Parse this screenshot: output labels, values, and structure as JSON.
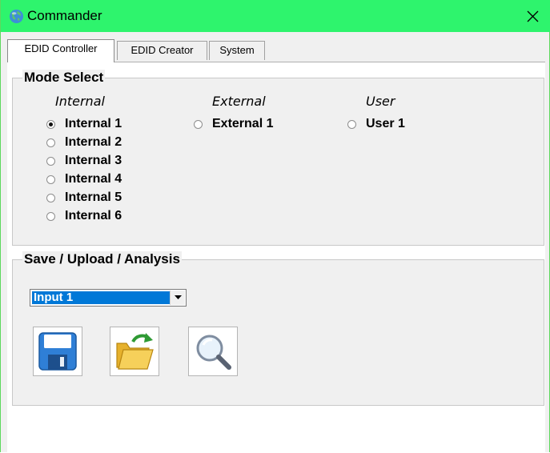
{
  "window": {
    "title": "Commander",
    "icon": "globe-icon",
    "close_icon": "close-icon",
    "titlebar_color": "#2ef46d"
  },
  "tabs": [
    {
      "label": "EDID Controller",
      "active": true
    },
    {
      "label": "EDID Creator",
      "active": false
    },
    {
      "label": "System",
      "active": false
    }
  ],
  "mode_select": {
    "title": "Mode Select",
    "columns": [
      {
        "header": "Internal",
        "options": [
          "Internal 1",
          "Internal 2",
          "Internal 3",
          "Internal 4",
          "Internal 5",
          "Internal 6"
        ]
      },
      {
        "header": "External",
        "options": [
          "External 1"
        ]
      },
      {
        "header": "User",
        "options": [
          "User 1"
        ]
      }
    ],
    "selected": "Internal 1"
  },
  "save_upload": {
    "title": "Save / Upload / Analysis",
    "input_select": {
      "value": "Input 1",
      "arrow_icon": "chevron-down-icon"
    },
    "buttons": [
      {
        "name": "save-button",
        "icon": "floppy-disk-icon"
      },
      {
        "name": "upload-button",
        "icon": "folder-upload-icon"
      },
      {
        "name": "analysis-button",
        "icon": "magnifier-icon"
      }
    ]
  },
  "colors": {
    "accent": "#0078d7",
    "floppy": "#2f7fd6",
    "folder": "#f6c743",
    "arrow": "#2f9a34"
  }
}
